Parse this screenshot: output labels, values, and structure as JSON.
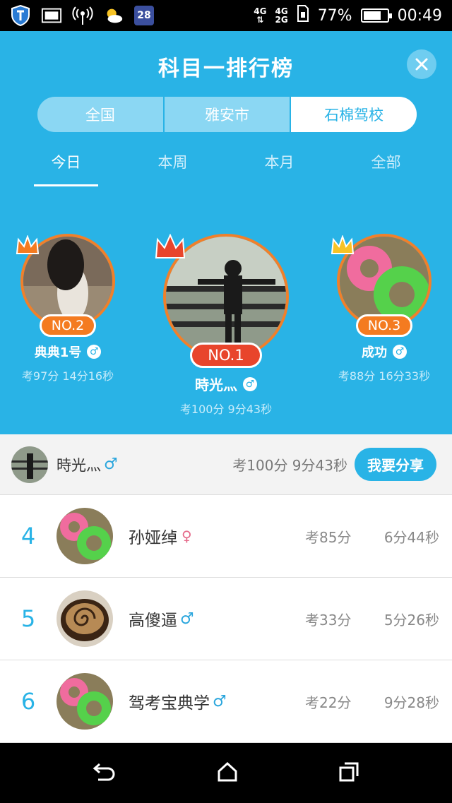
{
  "status": {
    "notify_badge": "28",
    "net_4g": "4G",
    "net_4g_signal": "4G",
    "net_2g": "2G",
    "battery": "77%",
    "battery_level": 0.77,
    "time": "00:49"
  },
  "header": {
    "title": "科目一排行榜",
    "segments": [
      "全国",
      "雅安市",
      "石棉驾校"
    ],
    "active_segment": 2,
    "tabs": [
      "今日",
      "本周",
      "本月",
      "全部"
    ],
    "active_tab": 0
  },
  "podium": {
    "first": {
      "rank": "NO.1",
      "name": "時光灬",
      "score": "考100分 9分43秒"
    },
    "second": {
      "rank": "NO.2",
      "name": "典典1号",
      "score": "考97分 14分16秒"
    },
    "third": {
      "rank": "NO.3",
      "name": "成功",
      "score": "考88分 16分33秒"
    }
  },
  "me": {
    "name": "時光灬",
    "score": "考100分 9分43秒",
    "share_label": "我要分享"
  },
  "list": [
    {
      "rank": "4",
      "name": "孙娅绰",
      "gender": "female",
      "score": "考85分",
      "time": "6分44秒"
    },
    {
      "rank": "5",
      "name": "高傻逼",
      "gender": "male",
      "score": "考33分",
      "time": "5分26秒"
    },
    {
      "rank": "6",
      "name": "驾考宝典学",
      "gender": "male",
      "score": "考22分",
      "time": "9分28秒"
    }
  ],
  "colors": {
    "primary": "#29b3e6",
    "orange": "#f47b20",
    "red": "#e8452c"
  }
}
